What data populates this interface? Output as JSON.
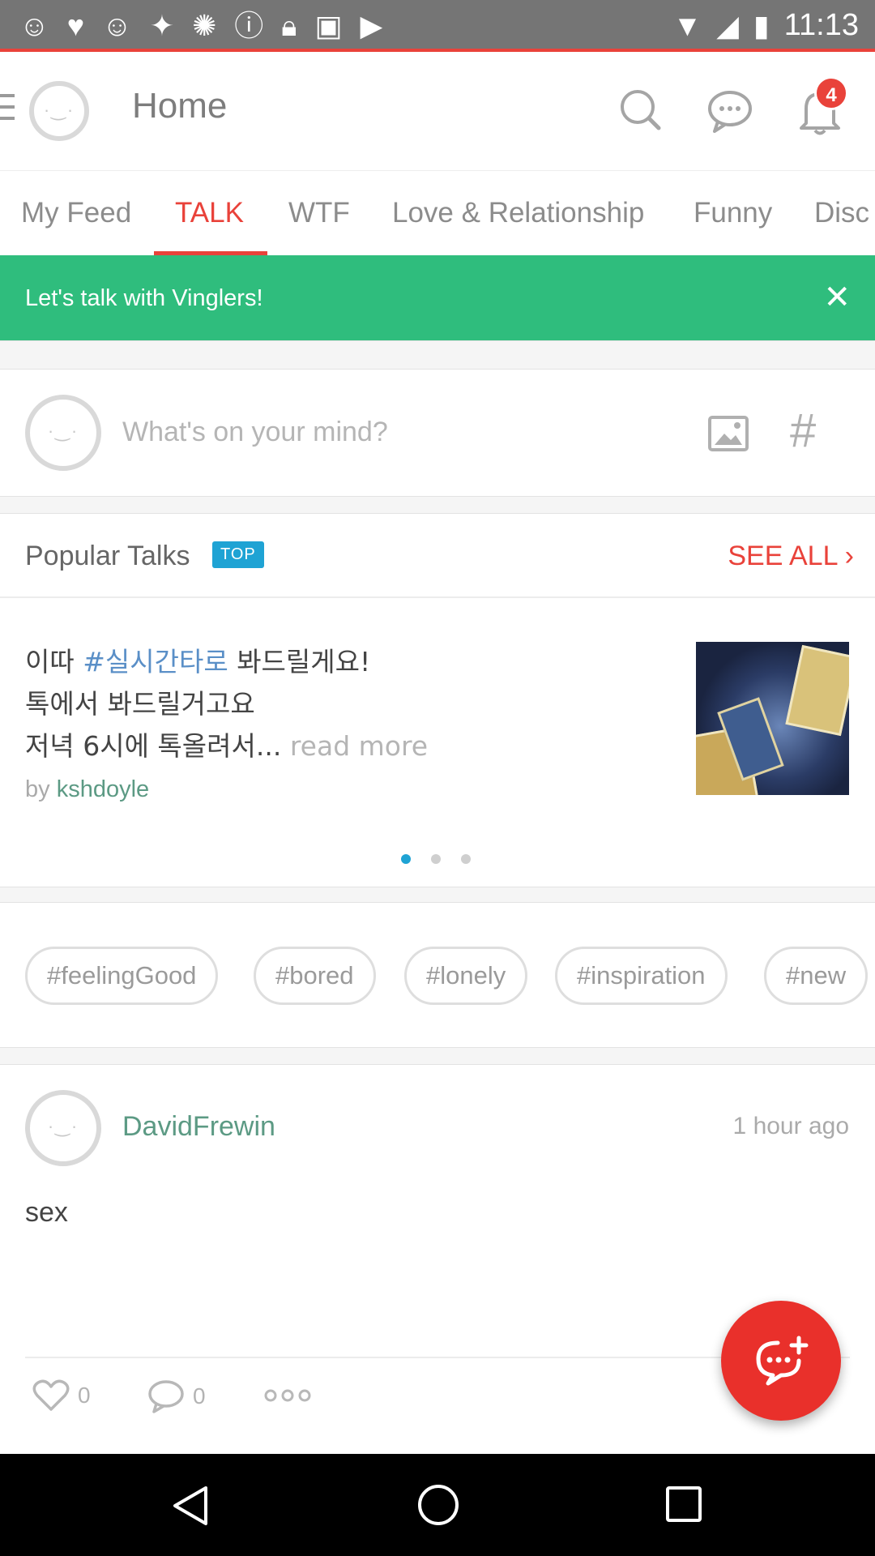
{
  "status_bar": {
    "time": "11:13",
    "notif_icons": [
      "smiley-icon",
      "heart-icon",
      "smiley-icon",
      "satellite-icon",
      "lightbulb-icon",
      "info-icon",
      "lock-icon",
      "gamepad-icon",
      "briefcase-icon"
    ]
  },
  "header": {
    "title": "Home",
    "notification_count": "4"
  },
  "tabs": [
    "My Feed",
    "TALK",
    "WTF",
    "Love & Relationship",
    "Funny",
    "Disc"
  ],
  "active_tab": "TALK",
  "banner": {
    "text": "Let's talk with Vinglers!"
  },
  "composer": {
    "placeholder": "What's on your mind?",
    "hash_symbol": "#"
  },
  "popular": {
    "title": "Popular Talks",
    "badge": "TOP",
    "see_all": "SEE ALL",
    "post": {
      "line1_prefix": "이따",
      "line1_hashtag": "#실시간타로",
      "line1_suffix": "봐드릴게요!",
      "line2": "톡에서 봐드릴거고요",
      "line3": "저녁 6시에 톡올려서...",
      "read_more": "read more",
      "by_label": "by",
      "author": "kshdoyle"
    }
  },
  "hashtags": [
    "#feelingGood",
    "#bored",
    "#lonely",
    "#inspiration",
    "#new"
  ],
  "feed_post": {
    "username": "DavidFrewin",
    "time_ago": "1 hour ago",
    "body": "sex",
    "like_count": "0",
    "comment_count": "0"
  },
  "colors": {
    "accent": "#e9423a",
    "banner": "#2fbd7d",
    "link_green": "#5c9a84",
    "hashtag_blue": "#5a8fc7",
    "top_badge": "#1fa3d4"
  }
}
